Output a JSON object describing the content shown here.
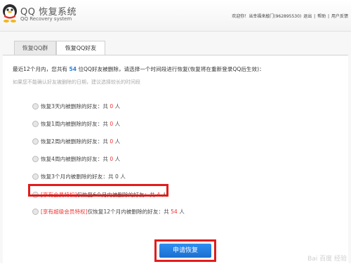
{
  "header": {
    "title": "QQ 恢复系统",
    "subtitle": "QQ Recovery system",
    "greeting": "欢迎你！当幸福来敲门(962895530)",
    "logout": "退出",
    "help": "帮助",
    "feedback": "用户反馈"
  },
  "tabs": [
    {
      "label": "恢复QQ群"
    },
    {
      "label": "恢复QQ好友"
    }
  ],
  "intro": {
    "prefix": "最近12个月内，您共有",
    "count": "54",
    "suffix": "位QQ好友被删除，请选择一个时间段进行恢复(恢复将在重新登录QQ后生效)："
  },
  "hint": "如果您不能确认好友被删除的日期，建议选择较长的时间段",
  "options": [
    {
      "prefix": "",
      "label": "恢复3天内被删除的好友：共",
      "count": "0",
      "unit": "人"
    },
    {
      "prefix": "",
      "label": "恢复1周内被删除的好友：共",
      "count": "0",
      "unit": "人"
    },
    {
      "prefix": "",
      "label": "恢复2周内被删除的好友：共",
      "count": "0",
      "unit": "人"
    },
    {
      "prefix": "",
      "label": "恢复4周内被删除的好友：共",
      "count": "0",
      "unit": "人"
    },
    {
      "prefix": "",
      "label": "恢复3个月内被删除的好友：共",
      "count": "0",
      "unit": "人"
    },
    {
      "prefix": "[享有会员特权]",
      "label": "仅恢复6个月内被删除的好友：共",
      "count": "4",
      "unit": "人"
    },
    {
      "prefix": "[享有超级会员特权]",
      "label": "仅恢复12个月内被删除的好友：共",
      "count": "54",
      "unit": "人"
    }
  ],
  "apply_button": "申请恢复",
  "watermark": "Bai 百度 经验",
  "colors": {
    "accent_blue": "#2a7fd4",
    "button_blue": "#1b6fd0",
    "highlight_red": "#e21c1c",
    "count_red": "#e33333"
  }
}
